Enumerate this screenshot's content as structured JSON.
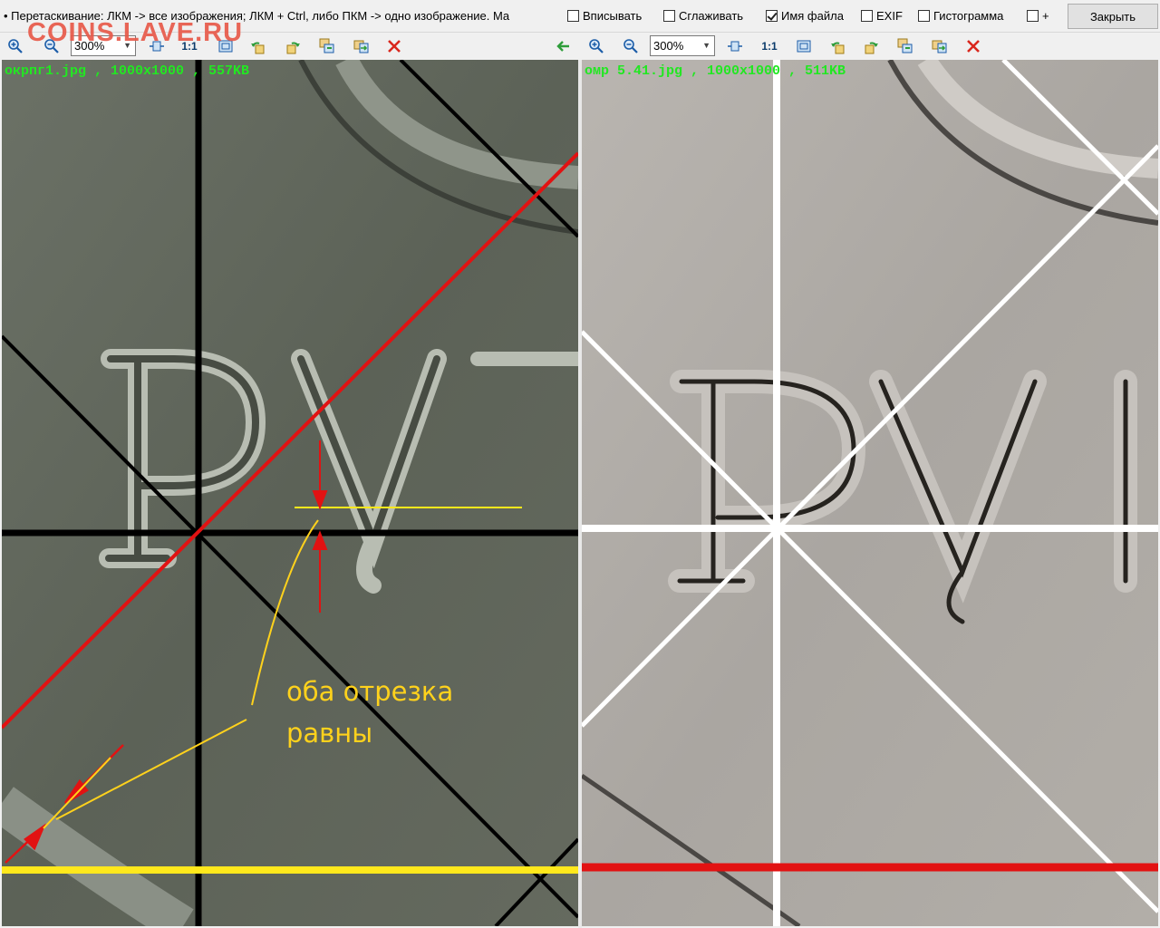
{
  "topbar": {
    "hint": "• Перетаскивание: ЛКМ -> все изображения; ЛКМ + Ctrl, либо ПКМ -> одно изображение. Ма",
    "options": [
      {
        "label": "Вписывать",
        "checked": false
      },
      {
        "label": "Сглаживать",
        "checked": false
      },
      {
        "label": "Имя файла",
        "checked": true
      },
      {
        "label": "EXIF",
        "checked": false
      },
      {
        "label": "Гистограмма",
        "checked": false
      },
      {
        "label": "+",
        "checked": false
      }
    ],
    "close_label": "Закрыть"
  },
  "watermark": "COINS.LAVE.RU",
  "left_panel": {
    "zoom": "300%",
    "one_to_one": "1:1",
    "file_label": "окрпг1.jpg , 1000x1000 , 557KB",
    "annotation_line1": "оба отрезка",
    "annotation_line2": "равны"
  },
  "right_panel": {
    "zoom": "300%",
    "one_to_one": "1:1",
    "file_label": "омр 5.41.jpg , 1000x1000 , 511KB"
  },
  "colors": {
    "red_line": "#e21212",
    "yellow_line": "#ffe81c",
    "file_label": "#22e722",
    "close_icon": "#d9261c",
    "annotation": "#ffd21c"
  }
}
